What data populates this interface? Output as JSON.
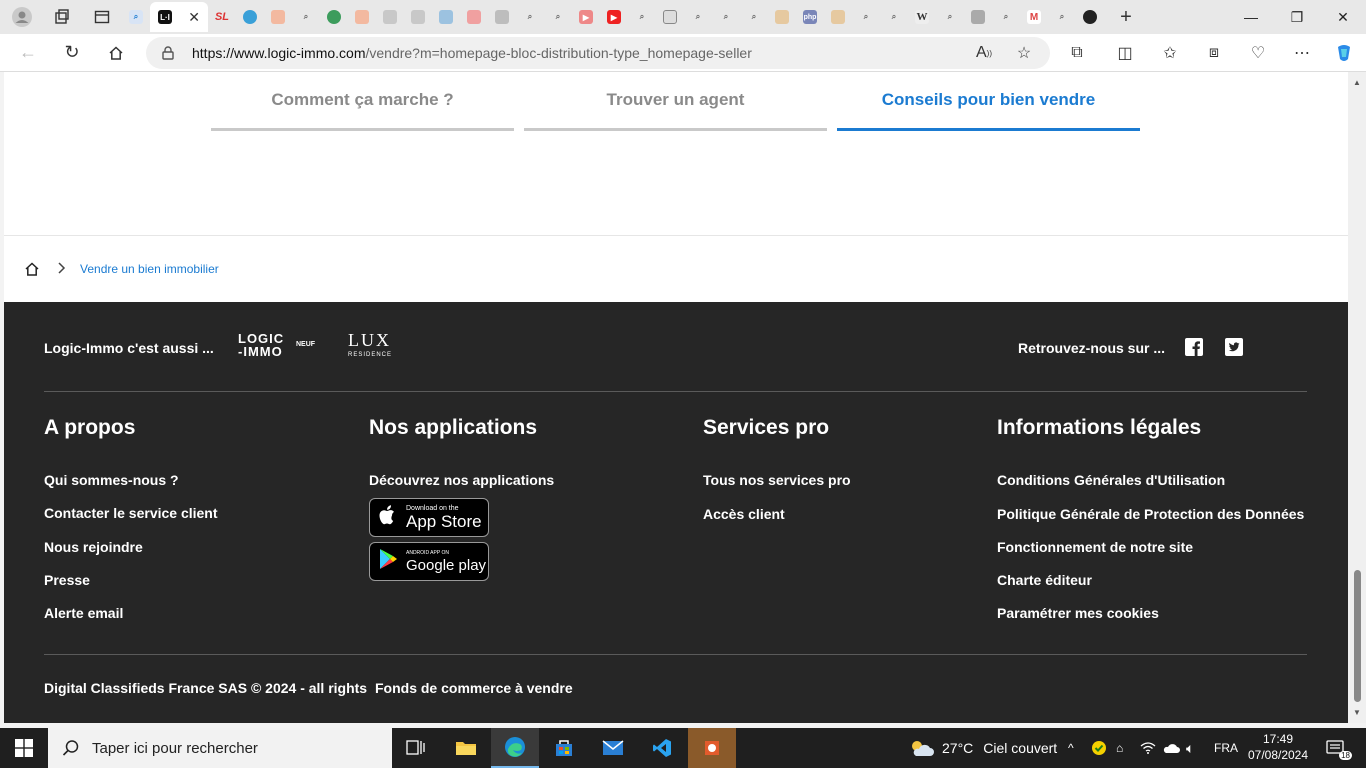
{
  "browser": {
    "active_tab_label": "L·I",
    "url_host": "https://www.logic-immo.com",
    "url_path": "/vendre?m=homepage-bloc-distribution-type_homepage-seller"
  },
  "subnav": {
    "tabs": [
      {
        "label": "Comment ça marche ?"
      },
      {
        "label": "Trouver un agent"
      },
      {
        "label": "Conseils pour bien vendre"
      }
    ]
  },
  "breadcrumb": {
    "current": "Vendre un bien immobilier"
  },
  "footer": {
    "also_label": "Logic-Immo c'est aussi ...",
    "logo_neuf": {
      "line1": "LOGIC",
      "line2": "-IMMO",
      "tag": "NEUF"
    },
    "logo_lux": {
      "mark": "LUX",
      "sub": "RESIDENCE"
    },
    "find_us_label": "Retrouvez-nous sur ...",
    "columns": {
      "about": {
        "title": "A propos",
        "links": [
          "Qui sommes-nous ?",
          "Contacter le service client",
          "Nous rejoindre",
          "Presse",
          "Alerte email"
        ]
      },
      "apps": {
        "title": "Nos applications",
        "link": "Découvrez nos applications",
        "app_store": {
          "small": "Download on the",
          "big": "App Store"
        },
        "google_play": {
          "small": "ANDROID APP ON",
          "big": "Google play"
        }
      },
      "pro": {
        "title": "Services pro",
        "links": [
          "Tous nos services pro",
          "Accès client"
        ]
      },
      "legal": {
        "title": "Informations légales",
        "links": [
          "Conditions Générales d'Utilisation",
          "Politique Générale de Protection des Données",
          "Fonctionnement de notre site",
          "Charte éditeur",
          "Paramétrer mes cookies"
        ]
      }
    },
    "copyright": "Digital Classifieds France SAS © 2024 - all rights",
    "fonds_link": "Fonds de commerce à vendre"
  },
  "taskbar": {
    "search_placeholder": "Taper ici pour rechercher",
    "weather_temp": "27°C",
    "weather_desc": "Ciel couvert",
    "language": "FRA",
    "time": "17:49",
    "date": "07/08/2024",
    "notifications": "18"
  },
  "colors": {
    "accent": "#1b7bd1",
    "footer_bg": "#262626"
  }
}
